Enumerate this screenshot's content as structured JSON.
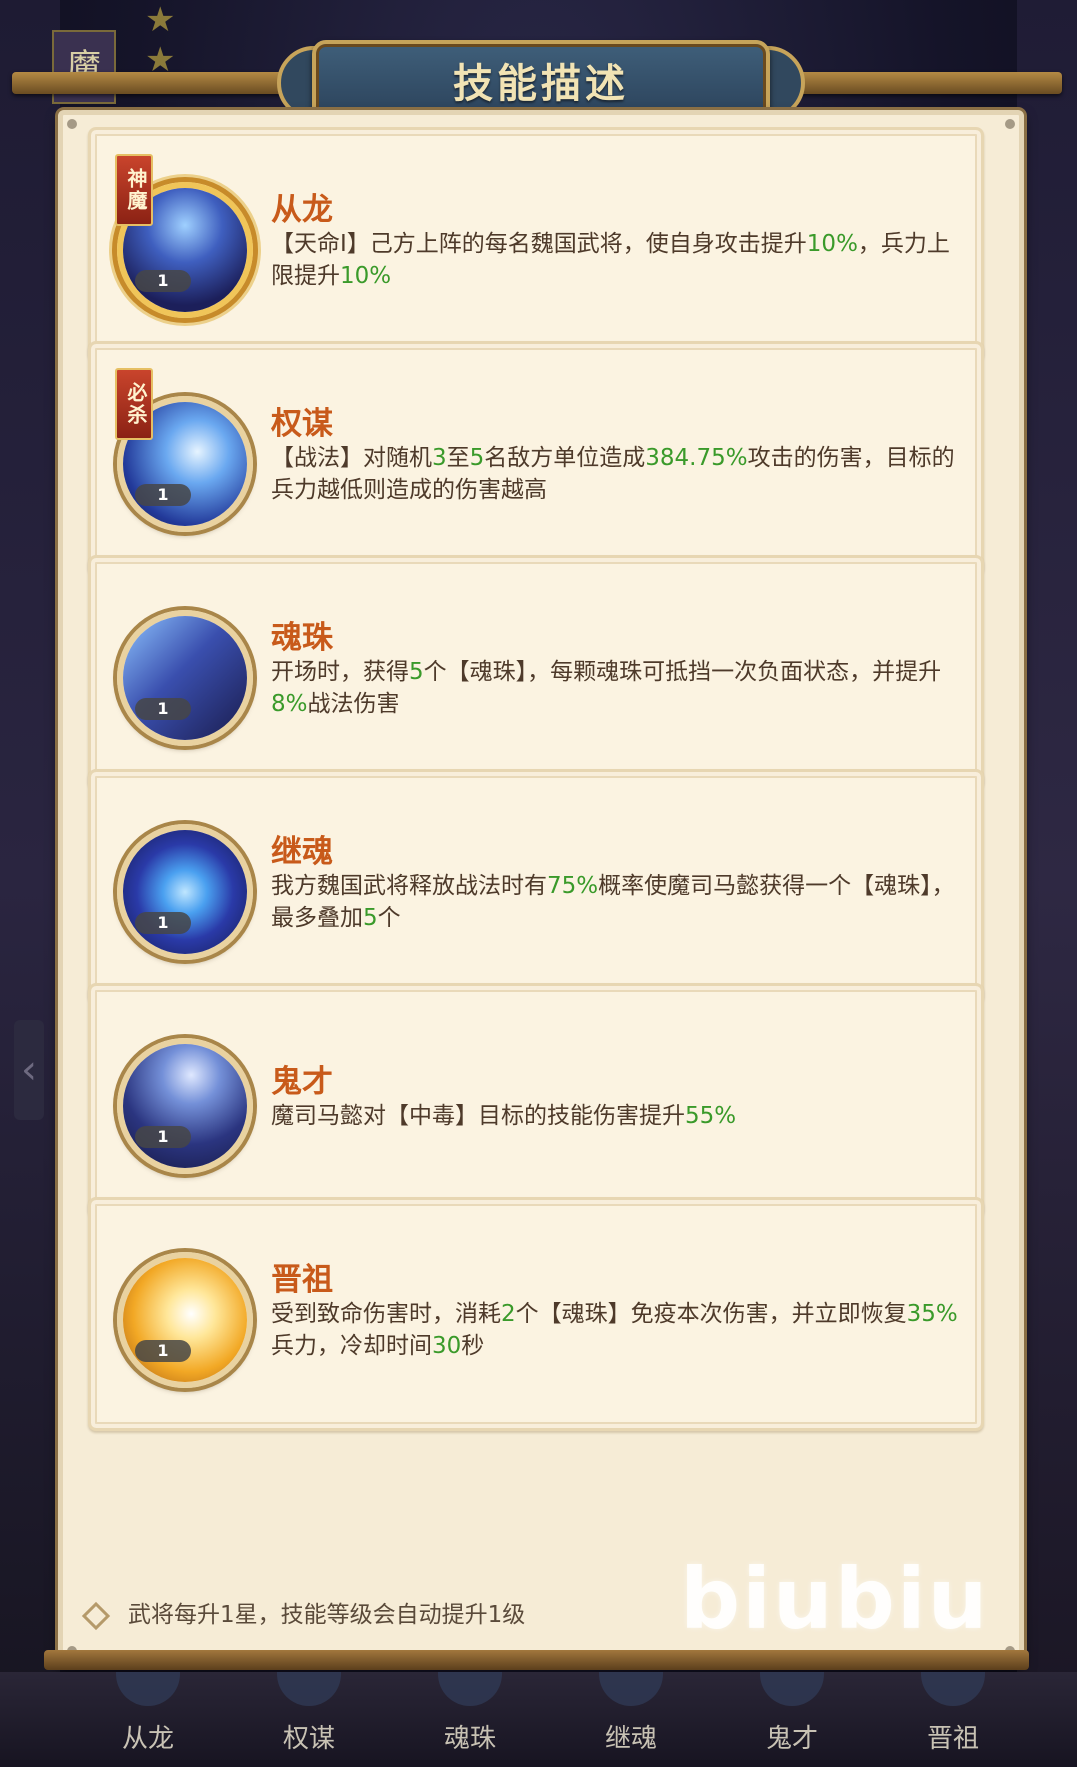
{
  "header": {
    "title": "技能描述"
  },
  "corner": {
    "badge_char": "魔"
  },
  "skills": [
    {
      "name": "从龙",
      "tag": "神魔",
      "level": "1",
      "icon": "ghost-warrior-icon",
      "desc_parts": [
        {
          "t": "【天命Ⅰ】己方上阵的每名魏国武将，使自身攻击提升"
        },
        {
          "t": "10%",
          "hl": true
        },
        {
          "t": "，兵力上限提升"
        },
        {
          "t": "10%",
          "hl": true
        }
      ]
    },
    {
      "name": "权谋",
      "tag": "必杀",
      "level": "1",
      "icon": "energy-burst-icon",
      "desc_parts": [
        {
          "t": "【战法】对随机"
        },
        {
          "t": "3",
          "hl": true
        },
        {
          "t": "至"
        },
        {
          "t": "5",
          "hl": true
        },
        {
          "t": "名敌方单位造成"
        },
        {
          "t": "384.75%",
          "hl": true
        },
        {
          "t": "攻击的伤害，目标的兵力越低则造成的伤害越高"
        }
      ]
    },
    {
      "name": "魂珠",
      "tag": "",
      "level": "1",
      "icon": "swordsman-icon",
      "desc_parts": [
        {
          "t": "开场时，获得"
        },
        {
          "t": "5",
          "hl": true
        },
        {
          "t": "个【魂珠】，每颗魂珠可抵挡一次负面状态，并提升"
        },
        {
          "t": "8%",
          "hl": true
        },
        {
          "t": "战法伤害"
        }
      ]
    },
    {
      "name": "继魂",
      "tag": "",
      "level": "1",
      "icon": "vortex-icon",
      "desc_parts": [
        {
          "t": "我方魏国武将释放战法时有"
        },
        {
          "t": "75%",
          "hl": true
        },
        {
          "t": "概率使魔司马懿获得一个【魂珠】，最多叠加"
        },
        {
          "t": "5",
          "hl": true
        },
        {
          "t": "个"
        }
      ]
    },
    {
      "name": "鬼才",
      "tag": "",
      "level": "1",
      "icon": "moon-figure-icon",
      "desc_parts": [
        {
          "t": "魔司马懿对【中毒】目标的技能伤害提升"
        },
        {
          "t": "55%",
          "hl": true
        }
      ]
    },
    {
      "name": "晋祖",
      "tag": "",
      "level": "1",
      "icon": "golden-wing-icon",
      "desc_parts": [
        {
          "t": "受到致命伤害时，消耗"
        },
        {
          "t": "2",
          "hl": true
        },
        {
          "t": "个【魂珠】免疫本次伤害，并立即恢复"
        },
        {
          "t": "35%",
          "hl": true
        },
        {
          "t": "兵力，冷却时间"
        },
        {
          "t": "30",
          "hl": true
        },
        {
          "t": "秒"
        }
      ]
    }
  ],
  "footer": {
    "note": "武将每升1星，技能等级会自动提升1级"
  },
  "watermark": "biubiu",
  "bottom_tabs": [
    "从龙",
    "权谋",
    "魂珠",
    "继魂",
    "鬼才",
    "晋祖"
  ],
  "colors": {
    "highlight": "#3a9a2a",
    "skill_name": "#c85a1a",
    "panel": "#f6ecd6"
  }
}
